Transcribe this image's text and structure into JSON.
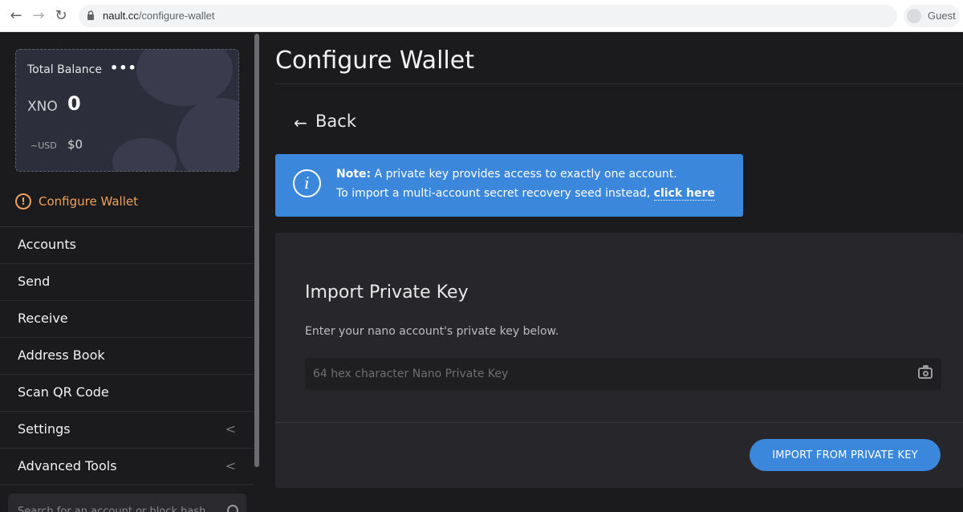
{
  "browser": {
    "url_host": "nault.cc",
    "url_path": "/configure-wallet",
    "profile_name": "Guest"
  },
  "balance": {
    "title": "Total Balance",
    "menu": "•••",
    "currency": "XNO",
    "amount": "0",
    "fiat_label": "~USD",
    "fiat_amount": "$0"
  },
  "sidebar": {
    "configure_label": "Configure Wallet",
    "warn_symbol": "!",
    "items": [
      {
        "label": "Accounts"
      },
      {
        "label": "Send"
      },
      {
        "label": "Receive"
      },
      {
        "label": "Address Book"
      },
      {
        "label": "Scan QR Code"
      },
      {
        "label": "Settings",
        "chevron": "<"
      },
      {
        "label": "Advanced Tools",
        "chevron": "<"
      }
    ],
    "search_placeholder": "Search for an account or block hash"
  },
  "main": {
    "title": "Configure Wallet",
    "back_arrow": "←",
    "back_label": "Back",
    "note": {
      "icon": "i",
      "label": "Note:",
      "line1": " A private key provides access to exactly one account.",
      "line2": "To import a multi-account secret recovery seed instead, ",
      "link": "click here"
    },
    "panel": {
      "heading": "Import Private Key",
      "description": "Enter your nano account's private key below.",
      "input_placeholder": "64 hex character Nano Private Key",
      "button_label": "IMPORT FROM PRIVATE KEY"
    }
  },
  "colors": {
    "accent": "#3a87db",
    "warning": "#f0a25a",
    "background": "#1b1b1e"
  }
}
